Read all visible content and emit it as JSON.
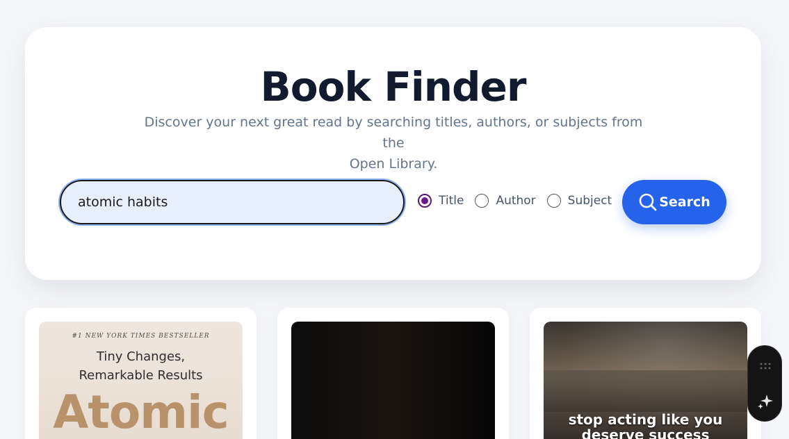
{
  "header": {
    "title": "Book Finder",
    "subtitle_line1": "Discover your next great read by searching titles, authors, or subjects from the",
    "subtitle_line2": "Open Library."
  },
  "search": {
    "value": "atomic habits",
    "button_label": "Search",
    "options": [
      {
        "label": "Title",
        "checked": true
      },
      {
        "label": "Author",
        "checked": false
      },
      {
        "label": "Subject",
        "checked": false
      }
    ]
  },
  "results": [
    {
      "cover_tag": "#1 NEW YORK TIMES BESTSELLER",
      "cover_line1": "Tiny Changes,",
      "cover_line2": "Remarkable Results",
      "cover_big": "Atomic"
    },
    {},
    {
      "cover_caption_line1": "stop acting like you",
      "cover_caption_line2": "deserve success"
    }
  ],
  "colors": {
    "accent": "#2563eb",
    "title": "#111a2e",
    "radio_checked": "#6a1b8a"
  },
  "icons": {
    "search_button": "search-icon",
    "widget_top": "grip-dots-icon",
    "widget_bottom": "sparkle-icon"
  }
}
